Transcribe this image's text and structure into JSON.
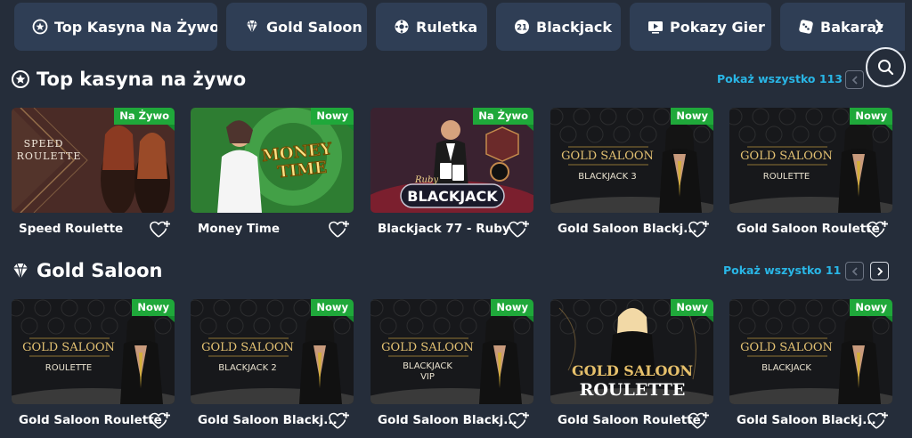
{
  "tabs": [
    {
      "label": "Top Kasyna Na Żywo",
      "icon": "star-circle-icon"
    },
    {
      "label": "Gold Saloon",
      "icon": "diamond-icon"
    },
    {
      "label": "Ruletka",
      "icon": "roulette-wheel-icon"
    },
    {
      "label": "Blackjack",
      "icon": "blackjack-21-icon"
    },
    {
      "label": "Pokazy Gier",
      "icon": "play-screen-icon"
    },
    {
      "label": "Bakarat",
      "icon": "dice-icon"
    }
  ],
  "sections": [
    {
      "title": "Top kasyna na żywo",
      "icon": "star-circle-icon",
      "show_all": "Pokaż wszystko 113",
      "games": [
        {
          "title": "Speed Roulette",
          "badge": "Na Żywo",
          "art": "SPEED ROULETTE"
        },
        {
          "title": "Money Time",
          "badge": "Nowy",
          "art": "MONEY TIME"
        },
        {
          "title": "Blackjack 77 - Ruby",
          "badge": "Na Żywo",
          "art": "BLACKJACK"
        },
        {
          "title": "Gold Saloon Blackj...",
          "badge": "Nowy",
          "art": "GOLD SALOON",
          "art_sub": "BLACKJACK 3"
        },
        {
          "title": "Gold Saloon Roulette",
          "badge": "Nowy",
          "art": "GOLD SALOON",
          "art_sub": "ROULETTE"
        }
      ]
    },
    {
      "title": "Gold Saloon",
      "icon": "diamond-icon",
      "show_all": "Pokaż wszystko 11",
      "games": [
        {
          "title": "Gold Saloon Roulette",
          "badge": "Nowy",
          "art": "GOLD SALOON",
          "art_sub": "ROULETTE"
        },
        {
          "title": "Gold Saloon Blackj...",
          "badge": "Nowy",
          "art": "GOLD SALOON",
          "art_sub": "BLACKJACK 2"
        },
        {
          "title": "Gold Saloon Blackj...",
          "badge": "Nowy",
          "art": "GOLD SALOON",
          "art_sub": "BLACKJACK VIP"
        },
        {
          "title": "Gold Saloon Roulette",
          "badge": "Nowy",
          "art": "GOLD SALOON",
          "art_sub": "ROULETTE"
        },
        {
          "title": "Gold Saloon Blackj...",
          "badge": "Nowy",
          "art": "GOLD SALOON",
          "art_sub": "BLACKJACK"
        }
      ]
    }
  ],
  "colors": {
    "background": "#252d3a",
    "tab": "#2f3e55",
    "link": "#29b6e6",
    "badge": "#1fa83a"
  }
}
